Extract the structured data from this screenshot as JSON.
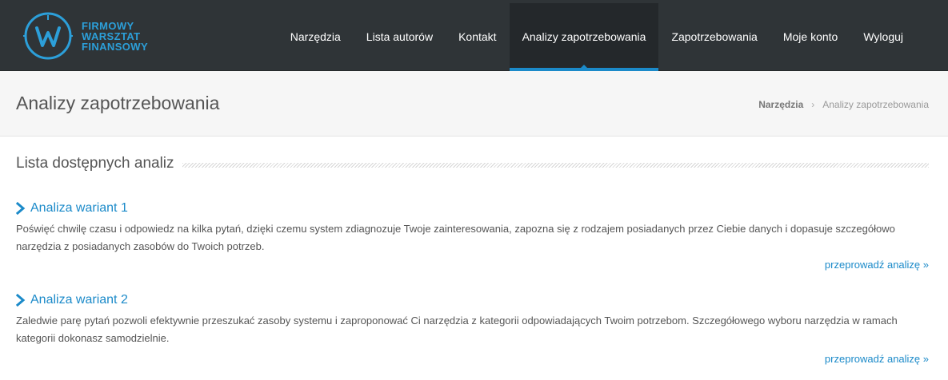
{
  "brand": {
    "lines": [
      "FIRMOWY",
      "WARSZTAT",
      "FINANSOWY"
    ],
    "accent_color": "#2c9fd9",
    "logo_icon": "fw-logo-icon"
  },
  "nav": {
    "items": [
      {
        "label": "Narzędzia"
      },
      {
        "label": "Lista autorów"
      },
      {
        "label": "Kontakt"
      },
      {
        "label": "Analizy zapotrzebowania",
        "active": true
      },
      {
        "label": "Zapotrzebowania"
      },
      {
        "label": "Moje konto"
      },
      {
        "label": "Wyloguj"
      }
    ],
    "background_color": "#2f3437",
    "active_color": "#1b8ac9"
  },
  "page": {
    "title": "Analizy zapotrzebowania",
    "breadcrumb": {
      "root": "Narzędzia",
      "separator": "›",
      "current": "Analizy zapotrzebowania"
    }
  },
  "section": {
    "title": "Lista dostępnych analiz"
  },
  "analyses": [
    {
      "title": "Analiza wariant 1",
      "description": "Poświęć chwilę czasu i odpowiedz na kilka pytań, dzięki czemu system zdiagnozuje Twoje zainteresowania, zapozna się z rodzajem posiadanych przez Ciebie danych i dopasuje szczegółowo narzędzia z posiadanych zasobów do Twoich potrzeb.",
      "link_label": "przeprowadź analizę »"
    },
    {
      "title": "Analiza wariant 2",
      "description": "Zaledwie parę pytań pozwoli efektywnie przeszukać zasoby systemu i zaproponować Ci narzędzia z kategorii odpowiadających Twoim potrzebom. Szczegółowego wyboru narzędzia w ramach kategorii dokonasz samodzielnie.",
      "link_label": "przeprowadź analizę »"
    }
  ],
  "icons": {
    "analysis_bullet": "chevron-right-icon"
  }
}
